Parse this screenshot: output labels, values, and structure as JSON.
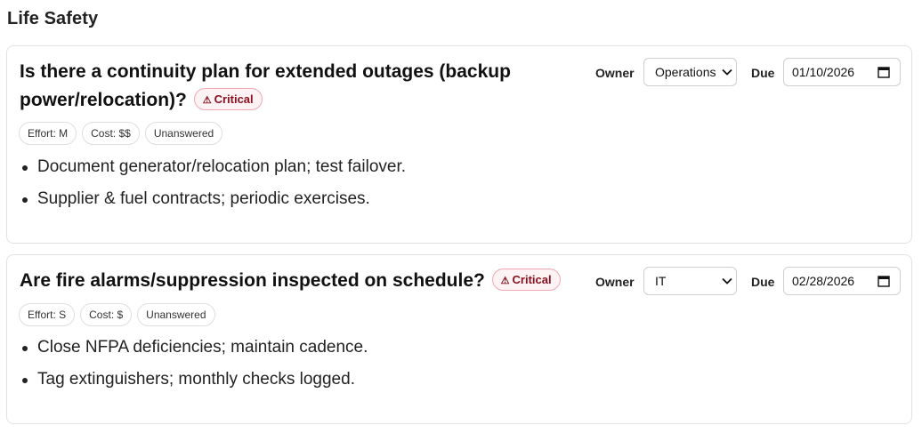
{
  "section": {
    "title": "Life Safety"
  },
  "cards": [
    {
      "question": "Is there a continuity plan for extended outages (backup power/relocation)?",
      "badge": {
        "icon": "warning-icon",
        "symbol": "⚠",
        "label": "Critical"
      },
      "chips": [
        "Effort: M",
        "Cost: $$",
        "Unanswered"
      ],
      "actions": [
        "Document generator/relocation plan; test failover.",
        "Supplier & fuel contracts; periodic exercises."
      ],
      "owner_label": "Owner",
      "owner_value": "Operations",
      "due_label": "Due",
      "due_value": "01/10/2026"
    },
    {
      "question": "Are fire alarms/suppression inspected on schedule?",
      "badge": {
        "icon": "warning-icon",
        "symbol": "⚠",
        "label": "Critical"
      },
      "chips": [
        "Effort: S",
        "Cost: $",
        "Unanswered"
      ],
      "actions": [
        "Close NFPA deficiencies; maintain cadence.",
        "Tag extinguishers; monthly checks logged."
      ],
      "owner_label": "Owner",
      "owner_value": "IT",
      "due_label": "Due",
      "due_value": "02/28/2026"
    }
  ],
  "colors": {
    "critical_text": "#8a1020",
    "critical_bg": "#fdf2f4",
    "critical_border": "#f0a8b2"
  }
}
